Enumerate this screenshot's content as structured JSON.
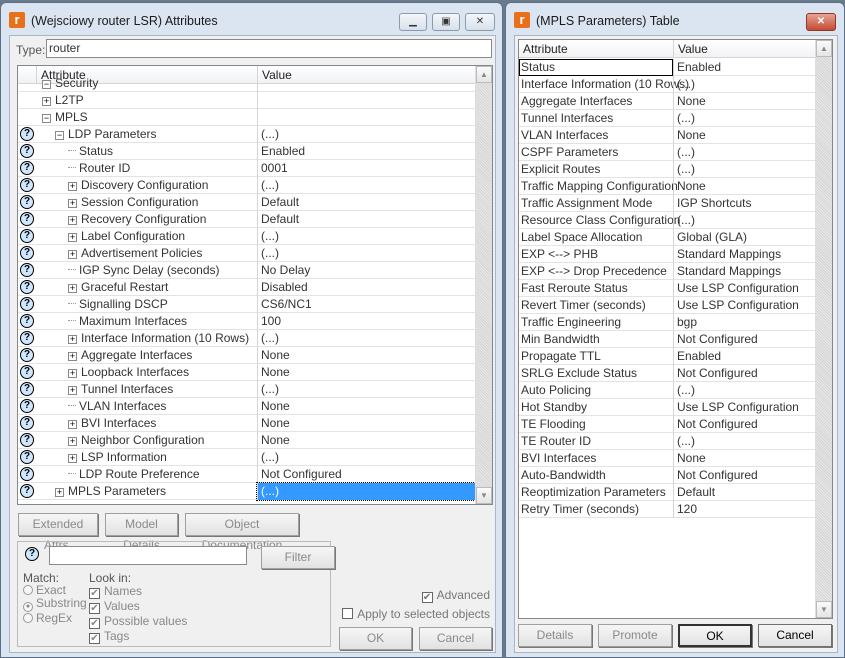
{
  "attr_window": {
    "title": "(Wejsciowy router LSR) Attributes",
    "type_label": "Type:",
    "type_value": "router",
    "columns": [
      "Attribute",
      "Value"
    ],
    "rows": [
      {
        "name": "Security",
        "value": "",
        "level": 0,
        "exp": "-",
        "help": false
      },
      {
        "name": "L2TP",
        "value": "",
        "level": 0,
        "exp": "+",
        "help": false
      },
      {
        "name": "MPLS",
        "value": "",
        "level": 0,
        "exp": "-",
        "help": false
      },
      {
        "name": "LDP Parameters",
        "value": "(...)",
        "level": 1,
        "exp": "-",
        "help": true
      },
      {
        "name": "Status",
        "value": "Enabled",
        "level": 2,
        "exp": "",
        "help": true
      },
      {
        "name": "Router ID",
        "value": "0001",
        "level": 2,
        "exp": "",
        "help": true
      },
      {
        "name": "Discovery Configuration",
        "value": "(...)",
        "level": 2,
        "exp": "+",
        "help": true
      },
      {
        "name": "Session Configuration",
        "value": "Default",
        "level": 2,
        "exp": "+",
        "help": true
      },
      {
        "name": "Recovery Configuration",
        "value": "Default",
        "level": 2,
        "exp": "+",
        "help": true
      },
      {
        "name": "Label Configuration",
        "value": "(...)",
        "level": 2,
        "exp": "+",
        "help": true
      },
      {
        "name": "Advertisement Policies",
        "value": "(...)",
        "level": 2,
        "exp": "+",
        "help": true
      },
      {
        "name": "IGP Sync Delay (seconds)",
        "value": "No Delay",
        "level": 2,
        "exp": "",
        "help": true
      },
      {
        "name": "Graceful Restart",
        "value": "Disabled",
        "level": 2,
        "exp": "+",
        "help": true
      },
      {
        "name": "Signalling DSCP",
        "value": "CS6/NC1",
        "level": 2,
        "exp": "",
        "help": true
      },
      {
        "name": "Maximum Interfaces",
        "value": "100",
        "level": 2,
        "exp": "",
        "help": true
      },
      {
        "name": "Interface Information (10 Rows)",
        "value": "(...)",
        "level": 2,
        "exp": "+",
        "help": true
      },
      {
        "name": "Aggregate Interfaces",
        "value": "None",
        "level": 2,
        "exp": "+",
        "help": true
      },
      {
        "name": "Loopback Interfaces",
        "value": "None",
        "level": 2,
        "exp": "+",
        "help": true
      },
      {
        "name": "Tunnel Interfaces",
        "value": "(...)",
        "level": 2,
        "exp": "+",
        "help": true
      },
      {
        "name": "VLAN Interfaces",
        "value": "None",
        "level": 2,
        "exp": "",
        "help": true
      },
      {
        "name": "BVI Interfaces",
        "value": "None",
        "level": 2,
        "exp": "+",
        "help": true
      },
      {
        "name": "Neighbor Configuration",
        "value": "None",
        "level": 2,
        "exp": "+",
        "help": true
      },
      {
        "name": "LSP Information",
        "value": "(...)",
        "level": 2,
        "exp": "+",
        "help": true
      },
      {
        "name": "LDP Route Preference",
        "value": "Not Configured",
        "level": 2,
        "exp": "",
        "help": true
      },
      {
        "name": "MPLS Parameters",
        "value": "(...)",
        "level": 1,
        "exp": "+",
        "help": true,
        "selected": true
      }
    ],
    "buttons": {
      "extended": "Extended Attrs.",
      "model": "Model Details",
      "doc": "Object Documentation",
      "filter": "Filter",
      "ok": "OK",
      "cancel": "Cancel"
    },
    "filter_value": "",
    "match_label": "Match:",
    "match_options": [
      "Exact",
      "Substring",
      "RegEx"
    ],
    "match_selected": "Substring",
    "lookin_label": "Look in:",
    "lookin_options": [
      "Names",
      "Values",
      "Possible values",
      "Tags"
    ],
    "advanced_label": "Advanced",
    "advanced_checked": true,
    "apply_label": "Apply to selected objects",
    "apply_checked": false
  },
  "table_window": {
    "title": "(MPLS Parameters) Table",
    "columns": [
      "Attribute",
      "Value"
    ],
    "rows": [
      [
        "Status",
        "Enabled"
      ],
      [
        "Interface Information (10 Rows)",
        "(...)"
      ],
      [
        "Aggregate Interfaces",
        "None"
      ],
      [
        "Tunnel Interfaces",
        "(...)"
      ],
      [
        "VLAN Interfaces",
        "None"
      ],
      [
        "CSPF Parameters",
        "(...)"
      ],
      [
        "Explicit Routes",
        "(...)"
      ],
      [
        "Traffic Mapping Configuration",
        "None"
      ],
      [
        "Traffic Assignment Mode",
        "IGP Shortcuts"
      ],
      [
        "Resource Class Configuration",
        "(...)"
      ],
      [
        "Label Space Allocation",
        "Global (GLA)"
      ],
      [
        "EXP <--> PHB",
        "Standard Mappings"
      ],
      [
        "EXP <--> Drop Precedence",
        "Standard Mappings"
      ],
      [
        "Fast Reroute Status",
        "Use LSP Configuration"
      ],
      [
        "Revert Timer (seconds)",
        "Use LSP Configuration"
      ],
      [
        "Traffic Engineering",
        "bgp"
      ],
      [
        "Min Bandwidth",
        "Not Configured"
      ],
      [
        "Propagate TTL",
        "Enabled"
      ],
      [
        "SRLG Exclude Status",
        "Not Configured"
      ],
      [
        "Auto Policing",
        "(...)"
      ],
      [
        "Hot Standby",
        "Use LSP Configuration"
      ],
      [
        "TE Flooding",
        "Not Configured"
      ],
      [
        "TE Router ID",
        "(...)"
      ],
      [
        "BVI Interfaces",
        "None"
      ],
      [
        "Auto-Bandwidth",
        "Not Configured"
      ],
      [
        "Reoptimization Parameters",
        "Default"
      ],
      [
        "Retry Timer (seconds)",
        "120"
      ]
    ],
    "buttons": {
      "details": "Details",
      "promote": "Promote",
      "ok": "OK",
      "cancel": "Cancel"
    }
  },
  "colors": {
    "selection": "#3399ff",
    "frame": "#dbe5f1",
    "logo": "#e8701a"
  }
}
